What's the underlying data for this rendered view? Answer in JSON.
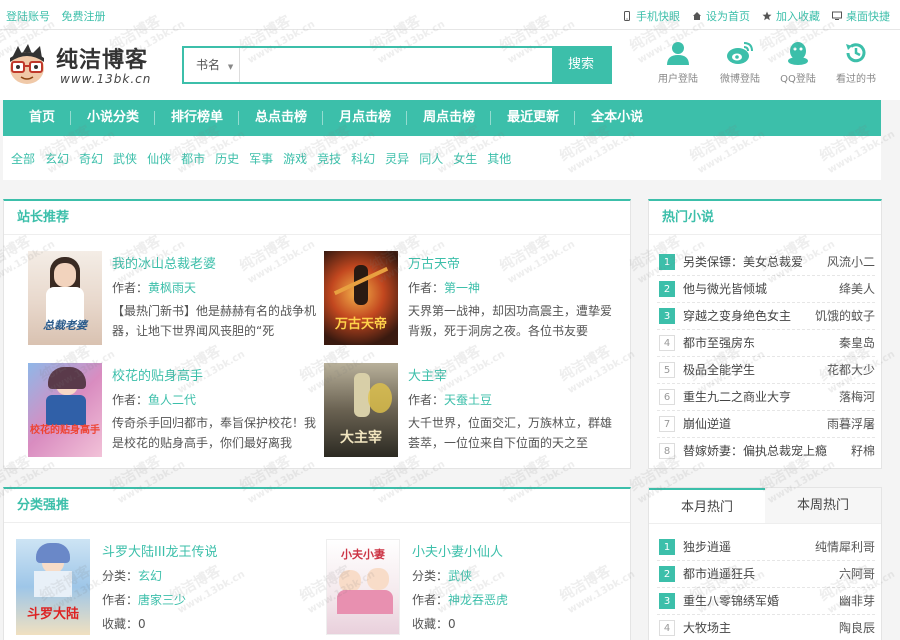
{
  "topbar": {
    "login": "登陆账号",
    "register": "免费注册",
    "links": [
      {
        "label": "手机快眼",
        "icon": "phone-icon"
      },
      {
        "label": "设为首页",
        "icon": "home-icon"
      },
      {
        "label": "加入收藏",
        "icon": "star-icon"
      },
      {
        "label": "桌面快捷",
        "icon": "desktop-icon"
      }
    ]
  },
  "logo": {
    "name": "纯洁博客",
    "url": "www.13bk.cn"
  },
  "search": {
    "category": "书名",
    "value": "",
    "button": "搜索"
  },
  "quick_links": [
    {
      "label": "用户登陆",
      "icon": "user-icon"
    },
    {
      "label": "微博登陆",
      "icon": "weibo-icon"
    },
    {
      "label": "QQ登陆",
      "icon": "qq-icon"
    },
    {
      "label": "看过的书",
      "icon": "history-icon"
    }
  ],
  "nav": [
    "首页",
    "小说分类",
    "排行榜单",
    "总点击榜",
    "月点击榜",
    "周点击榜",
    "最近更新",
    "全本小说"
  ],
  "genres": [
    "全部",
    "玄幻",
    "奇幻",
    "武侠",
    "仙侠",
    "都市",
    "历史",
    "军事",
    "游戏",
    "竞技",
    "科幻",
    "灵异",
    "同人",
    "女生",
    "其他"
  ],
  "recommend": {
    "title": "站长推荐",
    "author_prefix": "作者：",
    "books": [
      {
        "title": "我的冰山总裁老婆",
        "author": "黄枫雨天",
        "desc": "【最热门新书】他是赫赫有名的战争机器，让地下世界闻风丧胆的“死",
        "cover_text": "总裁老婆"
      },
      {
        "title": "万古天帝",
        "author": "第一神",
        "desc": "天界第一战神，却因功高震主，遭挚爱背叛，死于洞房之夜。各位书友要",
        "cover_text": "万古天帝"
      },
      {
        "title": "校花的贴身高手",
        "author": "鱼人二代",
        "desc": "传奇杀手回归都市，奉旨保护校花！我是校花的贴身高手，你们最好离我",
        "cover_text": "校花的贴身高手"
      },
      {
        "title": "大主宰",
        "author": "天蚕土豆",
        "desc": "大千世界，位面交汇，万族林立，群雄荟萃，一位位来自下位面的天之至",
        "cover_text": "大主宰"
      }
    ]
  },
  "hot": {
    "title": "热门小说",
    "items": [
      {
        "rank": "1",
        "name": "另类保镖：美女总裁爱",
        "author": "风流小二"
      },
      {
        "rank": "2",
        "name": "他与微光皆倾城",
        "author": "绛美人"
      },
      {
        "rank": "3",
        "name": "穿越之变身绝色女主",
        "author": "饥饿的蚊子"
      },
      {
        "rank": "4",
        "name": "都市至强房东",
        "author": "秦皇岛"
      },
      {
        "rank": "5",
        "name": "极品全能学生",
        "author": "花都大少"
      },
      {
        "rank": "6",
        "name": "重生九二之商业大亨",
        "author": "落梅河"
      },
      {
        "rank": "7",
        "name": "崩仙逆道",
        "author": "雨暮浮屠"
      },
      {
        "rank": "8",
        "name": "替嫁娇妻：偏执总裁宠上瘾",
        "author": "籽棉"
      }
    ]
  },
  "category": {
    "title": "分类强推",
    "type_prefix": "分类：",
    "author_prefix": "作者：",
    "fav_prefix": "收藏：",
    "books": [
      {
        "title": "斗罗大陆III龙王传说",
        "type": "玄幻",
        "author": "唐家三少",
        "fav": "0",
        "cover_text": "斗罗大陆"
      },
      {
        "title": "小夫小妻小仙人",
        "type": "武侠",
        "author": "神龙吞恶虎",
        "fav": "0",
        "cover_text": "小夫小妻"
      }
    ]
  },
  "month": {
    "tabs": [
      "本月热门",
      "本周热门"
    ],
    "items": [
      {
        "rank": "1",
        "name": "独步逍遥",
        "author": "纯情犀利哥"
      },
      {
        "rank": "2",
        "name": "都市逍遥狂兵",
        "author": "六阿哥"
      },
      {
        "rank": "3",
        "name": "重生八零锦绣军婚",
        "author": "幽非芽"
      },
      {
        "rank": "4",
        "name": "大牧场主",
        "author": "陶良辰"
      }
    ]
  },
  "watermark": {
    "text": "纯洁博客",
    "url": "www.13bk.cn"
  },
  "colors": {
    "accent": "#3cbfaa",
    "background": "#f4f4f4"
  }
}
